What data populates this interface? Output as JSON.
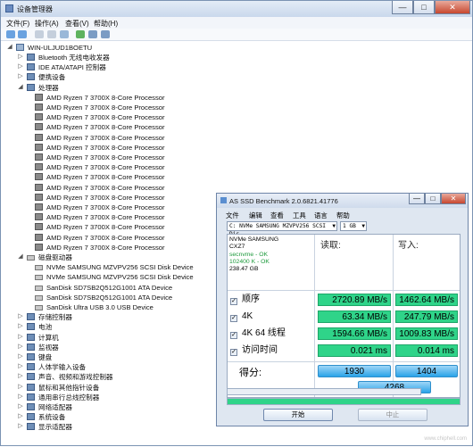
{
  "window": {
    "title": "设备管理器",
    "close": "✕",
    "min": "—",
    "max": "□"
  },
  "menu": [
    "文件(F)",
    "操作(A)",
    "查看(V)",
    "帮助(H)"
  ],
  "toolbar_icons": [
    "back-icon",
    "forward-icon",
    "properties-icon",
    "help-icon",
    "scan-icon",
    "update-driver-icon",
    "uninstall-icon",
    "disable-icon"
  ],
  "tree": {
    "root": "WIN-ULJUD1BOETU",
    "nodes": [
      {
        "label": "Bluetooth 无线电收发器",
        "exp": "▷",
        "icon": "bluetooth-icon"
      },
      {
        "label": "IDE ATA/ATAPI 控制器",
        "exp": "▷",
        "icon": "ide-controller-icon"
      },
      {
        "label": "便携设备",
        "exp": "▷",
        "icon": "portable-device-icon"
      },
      {
        "label": "处理器",
        "exp": "◢",
        "icon": "processor-icon"
      }
    ],
    "processors": [
      "AMD Ryzen 7 3700X 8-Core Processor",
      "AMD Ryzen 7 3700X 8-Core Processor",
      "AMD Ryzen 7 3700X 8-Core Processor",
      "AMD Ryzen 7 3700X 8-Core Processor",
      "AMD Ryzen 7 3700X 8-Core Processor",
      "AMD Ryzen 7 3700X 8-Core Processor",
      "AMD Ryzen 7 3700X 8-Core Processor",
      "AMD Ryzen 7 3700X 8-Core Processor",
      "AMD Ryzen 7 3700X 8-Core Processor",
      "AMD Ryzen 7 3700X 8-Core Processor",
      "AMD Ryzen 7 3700X 8-Core Processor",
      "AMD Ryzen 7 3700X 8-Core Processor",
      "AMD Ryzen 7 3700X 8-Core Processor",
      "AMD Ryzen 7 3700X 8-Core Processor",
      "AMD Ryzen 7 3700X 8-Core Processor",
      "AMD Ryzen 7 3700X 8-Core Processor"
    ],
    "disk_group": "磁盘驱动器",
    "disks": [
      "NVMe SAMSUNG MZVPV256 SCSI Disk Device",
      "NVMe SAMSUNG MZVPV256 SCSI Disk Device",
      "SanDisk SD7SB2Q512G1001 ATA Device",
      "SanDisk SD7SB2Q512G1001 ATA Device",
      "SanDisk Ultra USB 3.0 USB Device"
    ],
    "others": [
      "存储控制器",
      "电池",
      "计算机",
      "监视器",
      "键盘",
      "人体学输入设备",
      "声音、视频和游戏控制器",
      "鼠标和其他指针设备",
      "通用串行总线控制器",
      "网络适配器",
      "系统设备",
      "显示适配器"
    ]
  },
  "ssd": {
    "title": "AS SSD Benchmark 2.0.6821.41776",
    "menu": [
      "文件",
      "编辑",
      "查看",
      "工具",
      "语言",
      "帮助"
    ],
    "drive_select": "C: NVMe SAMSUNG MZVPV256 SCSI Dis",
    "size_select": "1 GB",
    "info": {
      "model": "NVMe SAMSUNG",
      "firmware": "CXZ7",
      "driver": "secnvme - OK",
      "align": "102400 K - OK",
      "capacity": "238.47 GB"
    },
    "read_header": "读取:",
    "write_header": "写入:",
    "rows": [
      {
        "label": "顺序",
        "read": "2720.89 MB/s",
        "write": "1462.64 MB/s"
      },
      {
        "label": "4K",
        "read": "63.34 MB/s",
        "write": "247.79 MB/s"
      },
      {
        "label": "4K 64 线程",
        "read": "1594.66 MB/s",
        "write": "1009.83 MB/s"
      },
      {
        "label": "访问时间",
        "read": "0.021 ms",
        "write": "0.014 ms"
      }
    ],
    "score_label": "得分:",
    "score_read": "1930",
    "score_write": "1404",
    "score_total": "4268",
    "progress1": 0,
    "progress2": 1.0,
    "start": "开始",
    "stop": "中止",
    "check": "✓",
    "bar_color": "#2fd489",
    "score_color": "#2aa3e8"
  },
  "watermark": {
    "logo": "chiphell",
    "url": "www.chiphell.com"
  }
}
